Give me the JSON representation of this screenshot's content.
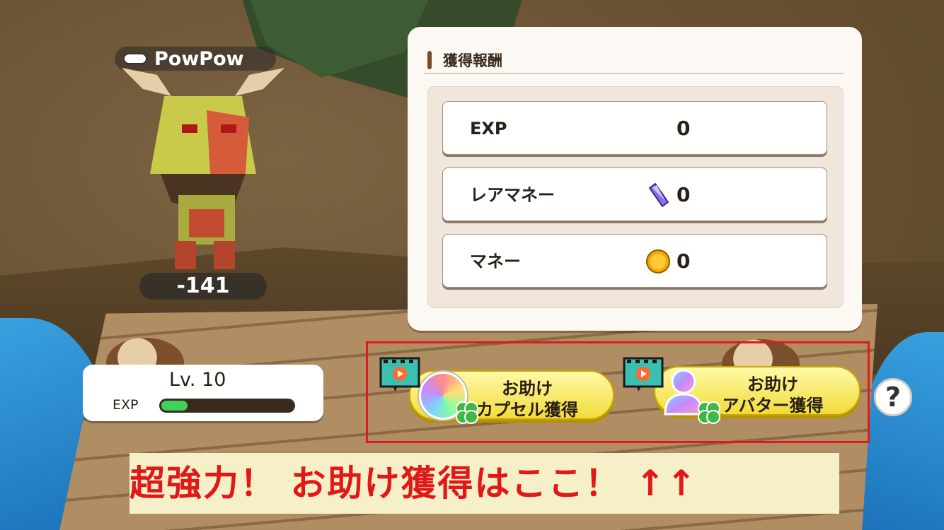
{
  "character": {
    "name": "PowPow",
    "damage_text": "-141"
  },
  "reward_panel": {
    "title": "獲得報酬",
    "rows": [
      {
        "label": "EXP",
        "value": "0",
        "icon": "none"
      },
      {
        "label": "レアマネー",
        "value": "0",
        "icon": "purple-crystal-icon"
      },
      {
        "label": "マネー",
        "value": "0",
        "icon": "gold-coin-icon"
      }
    ]
  },
  "level": {
    "label": "Lv. 10",
    "exp_label": "EXP",
    "exp_progress": 0.2
  },
  "help_buttons": [
    {
      "line1": "お助け",
      "line2": "カプセル獲得"
    },
    {
      "line1": "お助け",
      "line2": "アバター獲得"
    }
  ],
  "help_icon": "?",
  "banner": {
    "text": "超強力！ お助け獲得はここ！ ↑↑"
  },
  "colors": {
    "highlight_border": "#e01a1a",
    "banner_text": "#e01818",
    "button_yellow": "#f2dc3a",
    "exp_fill": "#3fd35a"
  }
}
